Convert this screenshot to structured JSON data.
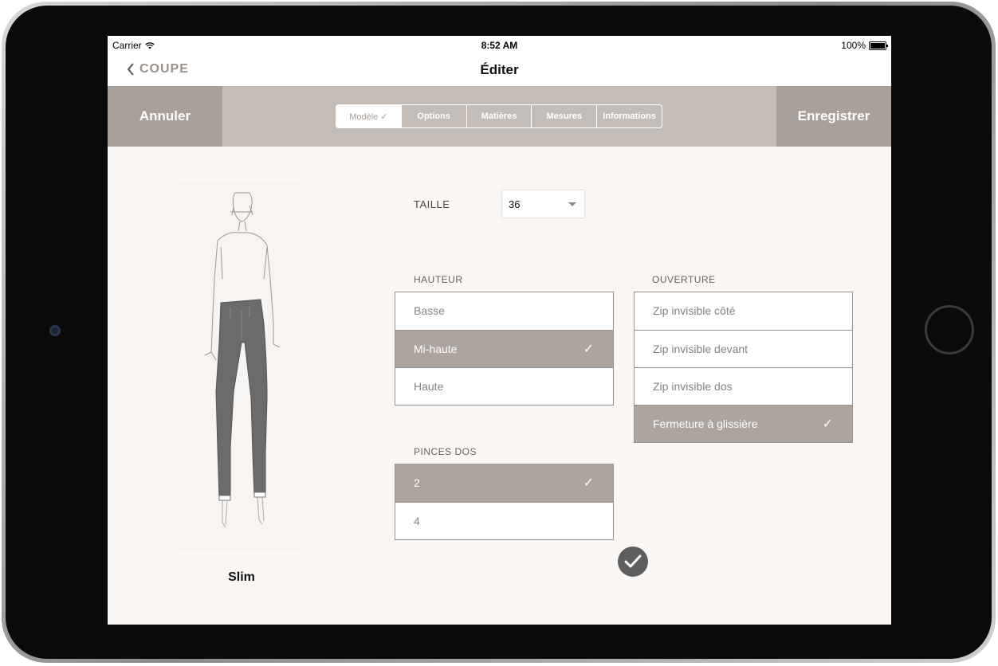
{
  "status": {
    "carrier": "Carrier",
    "time": "8:52 AM",
    "battery": "100%"
  },
  "nav": {
    "back_label": "COUPE",
    "title": "Éditer"
  },
  "toolbar": {
    "cancel_label": "Annuler",
    "save_label": "Enregistrer",
    "tabs": [
      {
        "label": "Modèle ✓"
      },
      {
        "label": "Options"
      },
      {
        "label": "Matières"
      },
      {
        "label": "Mesures"
      },
      {
        "label": "Informations"
      }
    ]
  },
  "model": {
    "name": "Slim"
  },
  "taille": {
    "label": "TAILLE",
    "value": "36"
  },
  "hauteur": {
    "label": "HAUTEUR",
    "items": [
      {
        "label": "Basse",
        "selected": false
      },
      {
        "label": "Mi-haute",
        "selected": true
      },
      {
        "label": "Haute",
        "selected": false
      }
    ]
  },
  "ouverture": {
    "label": "OUVERTURE",
    "items": [
      {
        "label": "Zip invisible côté",
        "selected": false
      },
      {
        "label": "Zip invisible devant",
        "selected": false
      },
      {
        "label": "Zip invisible dos",
        "selected": false
      },
      {
        "label": "Fermeture à glissière",
        "selected": true
      }
    ]
  },
  "pinces": {
    "label": "PINCES DOS",
    "items": [
      {
        "label": "2",
        "selected": true
      },
      {
        "label": "4",
        "selected": false
      }
    ]
  },
  "check_glyph": "✓",
  "colors": {
    "accent": "#ada49e",
    "toolbar": "#c4bcb6",
    "button": "#a9a09a",
    "background": "#faf7f4"
  }
}
